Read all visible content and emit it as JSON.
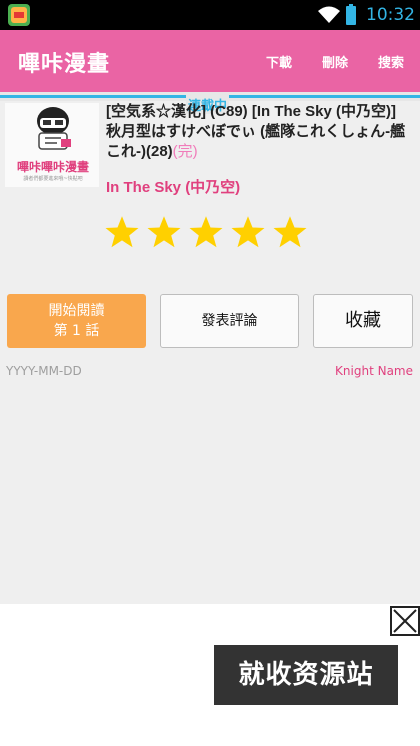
{
  "status_bar": {
    "time": "10:32"
  },
  "action_bar": {
    "title": "嗶咔漫畫",
    "actions": {
      "download": "下載",
      "delete": "刪除",
      "search": "搜索"
    },
    "status_tag": "連載中"
  },
  "cover": {
    "logo_text": "嗶咔嗶咔漫畫",
    "logo_sub": "讀者們都要進來哦~快點吧"
  },
  "comic": {
    "title": "[空気系☆漢化] (C89) [In The Sky (中乃空)] 秋月型はすけべぼでぃ (艦隊これくしょん-艦これ-)(28)",
    "complete_tag": "(完)",
    "author": "In The Sky (中乃空)",
    "rating": 5,
    "rating_max": 5,
    "date": "YYYY-MM-DD",
    "uploader": "Knight Name"
  },
  "buttons": {
    "read_line1": "開始閱讀",
    "read_line2": "第 1 話",
    "comment": "發表評論",
    "collect": "收藏"
  },
  "ad": {
    "banner_text": "就收资源站"
  },
  "colors": {
    "accent": "#ea64a4",
    "tab_indicator": "#33b5e5",
    "star": "#ffd000",
    "read_button": "#f9a74d"
  }
}
